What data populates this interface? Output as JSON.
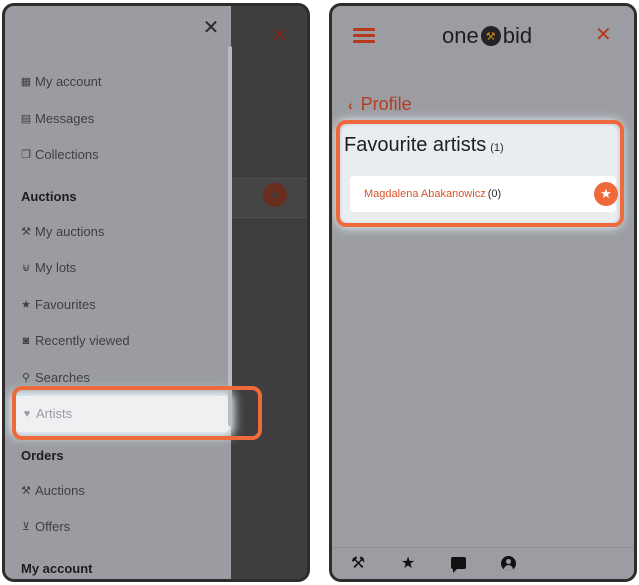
{
  "left_panel": {
    "close_icon": "close-icon",
    "menu": {
      "my_account": "My account",
      "messages": "Messages",
      "collections": "Collections",
      "auctions_header": "Auctions",
      "my_auctions": "My auctions",
      "my_lots": "My lots",
      "favourites": "Favourites",
      "recently_viewed": "Recently viewed",
      "searches": "Searches",
      "artists": "Artists",
      "orders_header": "Orders",
      "orders_auctions": "Auctions",
      "offers": "Offers",
      "my_account_header": "My account"
    }
  },
  "right_panel": {
    "logo": {
      "left": "one",
      "right": "bid"
    },
    "back_label": "Profile",
    "favourite_artists": {
      "title": "Favourite artists",
      "count": "(1)",
      "items": [
        {
          "name": "Magdalena Abakanowicz",
          "count": "(0)"
        }
      ]
    },
    "bottom_nav": [
      "gavel-icon",
      "star-icon",
      "chat-icon",
      "user-icon"
    ]
  },
  "colors": {
    "accent": "#ee6a3b",
    "brand_red": "#b83a1e",
    "overlay_gray": "#9a9ca1"
  }
}
